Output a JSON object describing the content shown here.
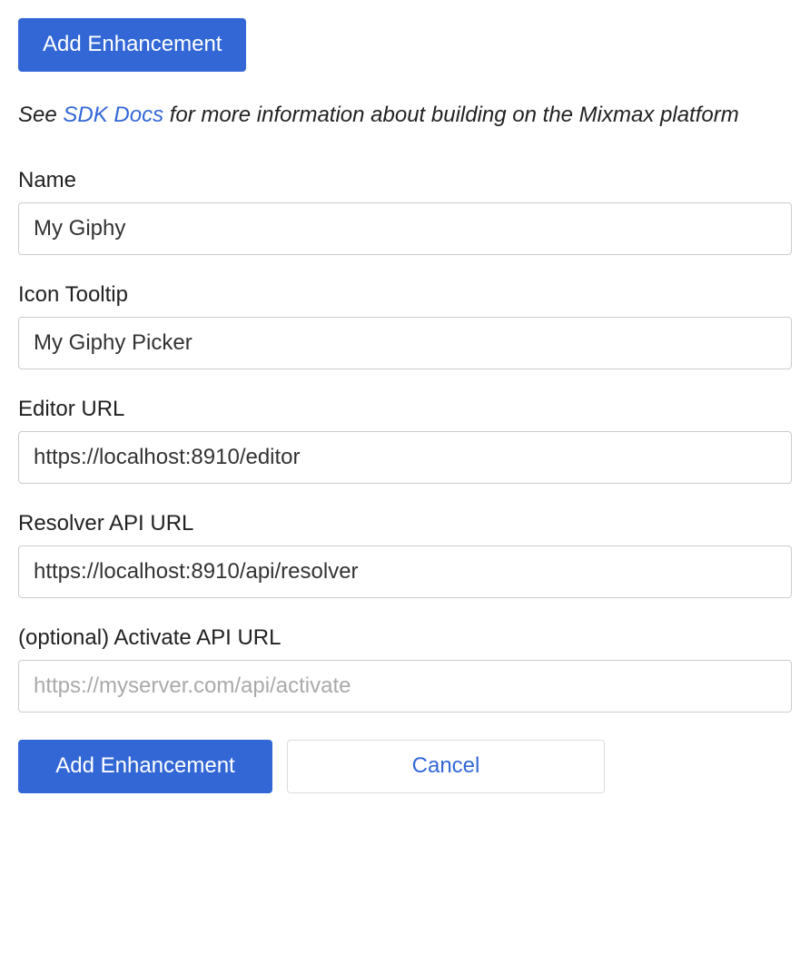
{
  "topButton": {
    "label": "Add Enhancement"
  },
  "infoText": {
    "prefix": "See ",
    "linkText": "SDK Docs",
    "suffix": " for more information about building on the Mixmax platform"
  },
  "fields": {
    "name": {
      "label": "Name",
      "value": "My Giphy"
    },
    "iconTooltip": {
      "label": "Icon Tooltip",
      "value": "My Giphy Picker"
    },
    "editorUrl": {
      "label": "Editor URL",
      "value": "https://localhost:8910/editor"
    },
    "resolverUrl": {
      "label": "Resolver API URL",
      "value": "https://localhost:8910/api/resolver"
    },
    "activateUrl": {
      "label": "(optional) Activate API URL",
      "value": "",
      "placeholder": "https://myserver.com/api/activate"
    }
  },
  "actions": {
    "submit": "Add Enhancement",
    "cancel": "Cancel"
  }
}
